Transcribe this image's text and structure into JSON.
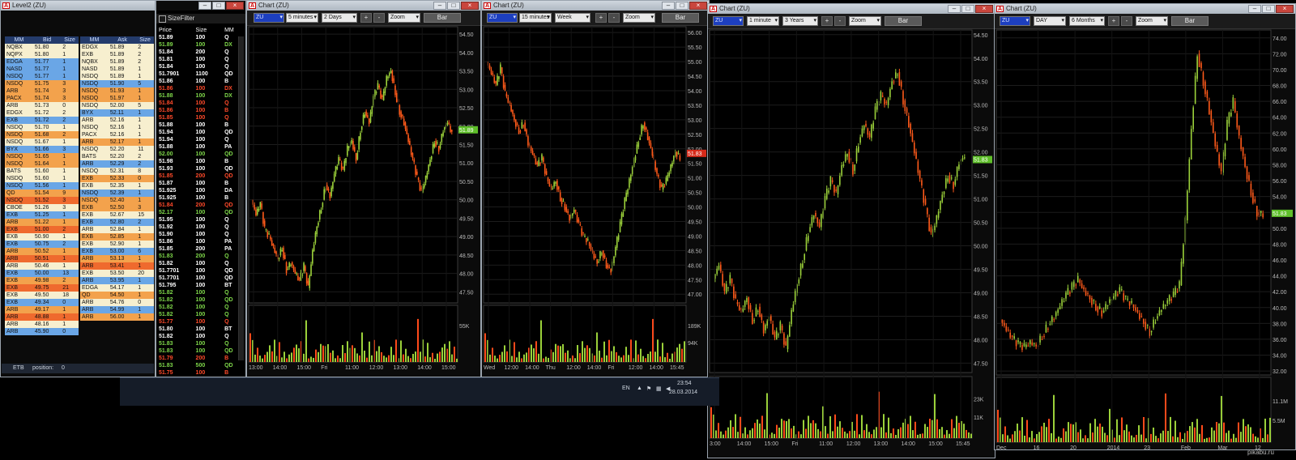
{
  "level2": {
    "title": "Level2 (ZU)",
    "bid_headers": [
      "MM",
      "Bid",
      "Size"
    ],
    "ask_headers": [
      "MM",
      "Ask",
      "Size"
    ],
    "bids": [
      [
        "NQBX",
        "51.80",
        "2",
        "cream"
      ],
      [
        "NQPX",
        "51.80",
        "1",
        "cream"
      ],
      [
        "EDGA",
        "51.77",
        "1",
        "blue"
      ],
      [
        "NASD",
        "51.77",
        "1",
        "blue"
      ],
      [
        "NSDQ",
        "51.77",
        "1",
        "blue"
      ],
      [
        "NSDQ",
        "51.75",
        "3",
        "orange"
      ],
      [
        "ARB",
        "51.74",
        "3",
        "orange"
      ],
      [
        "PACX",
        "51.74",
        "3",
        "orange"
      ],
      [
        "ARB",
        "51.73",
        "0",
        "cream"
      ],
      [
        "EDGX",
        "51.72",
        "2",
        "cream"
      ],
      [
        "EXB",
        "51.72",
        "2",
        "blue"
      ],
      [
        "NSDQ",
        "51.70",
        "1",
        "cream"
      ],
      [
        "NSDQ",
        "51.68",
        "2",
        "orange"
      ],
      [
        "NSDQ",
        "51.67",
        "1",
        "cream"
      ],
      [
        "BYX",
        "51.66",
        "3",
        "blue"
      ],
      [
        "NSDQ",
        "51.65",
        "1",
        "orange"
      ],
      [
        "NSDQ",
        "51.64",
        "1",
        "orange"
      ],
      [
        "BATS",
        "51.60",
        "1",
        "cream"
      ],
      [
        "NSDQ",
        "51.60",
        "1",
        "cream"
      ],
      [
        "NSDQ",
        "51.56",
        "1",
        "blue"
      ],
      [
        "QD",
        "51.54",
        "9",
        "orange"
      ],
      [
        "NSDQ",
        "51.52",
        "3",
        "red"
      ],
      [
        "CBOE",
        "51.26",
        "3",
        "cream"
      ],
      [
        "EXB",
        "51.25",
        "1",
        "blue"
      ],
      [
        "ARB",
        "51.22",
        "1",
        "orange"
      ],
      [
        "EXB",
        "51.00",
        "2",
        "red"
      ],
      [
        "EXB",
        "50.90",
        "1",
        "cream"
      ],
      [
        "EXB",
        "50.75",
        "2",
        "blue"
      ],
      [
        "ARB",
        "50.52",
        "1",
        "orange"
      ],
      [
        "ARB",
        "50.51",
        "1",
        "red"
      ],
      [
        "ARB",
        "50.46",
        "1",
        "cream"
      ],
      [
        "EXB",
        "50.00",
        "13",
        "blue"
      ],
      [
        "EXB",
        "49.98",
        "2",
        "orange"
      ],
      [
        "EXB",
        "49.75",
        "21",
        "red"
      ],
      [
        "EXB",
        "49.50",
        "18",
        "cream"
      ],
      [
        "EXB",
        "49.34",
        "0",
        "blue"
      ],
      [
        "ARB",
        "49.17",
        "1",
        "orange"
      ],
      [
        "ARB",
        "48.88",
        "1",
        "red"
      ],
      [
        "ARB",
        "48.16",
        "1",
        "cream"
      ],
      [
        "ARB",
        "45.90",
        "0",
        "blue"
      ]
    ],
    "asks": [
      [
        "EDGX",
        "51.89",
        "2",
        "cream"
      ],
      [
        "EXB",
        "51.89",
        "2",
        "cream"
      ],
      [
        "NQBX",
        "51.89",
        "2",
        "cream"
      ],
      [
        "NASD",
        "51.89",
        "1",
        "cream"
      ],
      [
        "NSDQ",
        "51.89",
        "1",
        "cream"
      ],
      [
        "NSDQ",
        "51.90",
        "5",
        "blue"
      ],
      [
        "NSDQ",
        "51.93",
        "1",
        "orange"
      ],
      [
        "NSDQ",
        "51.97",
        "1",
        "orange"
      ],
      [
        "NSDQ",
        "52.00",
        "5",
        "cream"
      ],
      [
        "BYX",
        "52.11",
        "1",
        "blue"
      ],
      [
        "ARB",
        "52.16",
        "1",
        "cream"
      ],
      [
        "NSDQ",
        "52.16",
        "1",
        "cream"
      ],
      [
        "PACX",
        "52.16",
        "1",
        "cream"
      ],
      [
        "ARB",
        "52.17",
        "1",
        "orange"
      ],
      [
        "NSDQ",
        "52.20",
        "11",
        "cream"
      ],
      [
        "BATS",
        "52.20",
        "2",
        "cream"
      ],
      [
        "ARB",
        "52.29",
        "2",
        "blue"
      ],
      [
        "NSDQ",
        "52.31",
        "8",
        "cream"
      ],
      [
        "EXB",
        "52.33",
        "0",
        "orange"
      ],
      [
        "EXB",
        "52.35",
        "1",
        "cream"
      ],
      [
        "NSDQ",
        "52.39",
        "1",
        "blue"
      ],
      [
        "NSDQ",
        "52.40",
        "1",
        "orange"
      ],
      [
        "EXB",
        "52.50",
        "3",
        "orange"
      ],
      [
        "EXB",
        "52.67",
        "15",
        "cream"
      ],
      [
        "EXB",
        "52.80",
        "2",
        "blue"
      ],
      [
        "ARB",
        "52.84",
        "1",
        "cream"
      ],
      [
        "EXB",
        "52.85",
        "1",
        "orange"
      ],
      [
        "EXB",
        "52.90",
        "1",
        "cream"
      ],
      [
        "EXB",
        "53.00",
        "6",
        "blue"
      ],
      [
        "ARB",
        "53.13",
        "1",
        "orange"
      ],
      [
        "ARB",
        "53.41",
        "1",
        "red"
      ],
      [
        "EXB",
        "53.50",
        "20",
        "cream"
      ],
      [
        "ARB",
        "53.95",
        "1",
        "blue"
      ],
      [
        "EDGA",
        "54.17",
        "1",
        "cream"
      ],
      [
        "QD",
        "54.50",
        "1",
        "orange"
      ],
      [
        "ARB",
        "54.76",
        "0",
        "cream"
      ],
      [
        "ARB",
        "54.99",
        "1",
        "blue"
      ],
      [
        "ARB",
        "56.00",
        "1",
        "orange"
      ]
    ],
    "status_symbol": "ETB",
    "status_position_label": "position:",
    "status_position_value": "0"
  },
  "sizefilter": {
    "title": "SizeFilter",
    "headers": [
      "Price",
      "Size",
      "MM"
    ],
    "rows": [
      [
        "51.89",
        "100",
        "Q",
        "w"
      ],
      [
        "51.89",
        "100",
        "DX",
        "g"
      ],
      [
        "51.84",
        "200",
        "Q",
        "w"
      ],
      [
        "51.81",
        "100",
        "Q",
        "w"
      ],
      [
        "51.84",
        "100",
        "Q",
        "w"
      ],
      [
        "51.7901",
        "1100",
        "QD",
        "w"
      ],
      [
        "51.86",
        "100",
        "B",
        "w"
      ],
      [
        "51.86",
        "100",
        "DX",
        "r"
      ],
      [
        "51.88",
        "100",
        "DX",
        "g"
      ],
      [
        "51.84",
        "100",
        "Q",
        "r"
      ],
      [
        "51.86",
        "100",
        "B",
        "r"
      ],
      [
        "51.85",
        "100",
        "Q",
        "r"
      ],
      [
        "51.88",
        "100",
        "B",
        "w"
      ],
      [
        "51.94",
        "100",
        "QD",
        "w"
      ],
      [
        "51.94",
        "100",
        "Q",
        "w"
      ],
      [
        "51.88",
        "100",
        "PA",
        "w"
      ],
      [
        "52.00",
        "100",
        "QD",
        "g"
      ],
      [
        "51.98",
        "100",
        "B",
        "w"
      ],
      [
        "51.93",
        "100",
        "QD",
        "w"
      ],
      [
        "51.85",
        "200",
        "QD",
        "r"
      ],
      [
        "51.87",
        "100",
        "B",
        "w"
      ],
      [
        "51.925",
        "100",
        "DA",
        "w"
      ],
      [
        "51.925",
        "100",
        "B",
        "w"
      ],
      [
        "51.84",
        "200",
        "QD",
        "r"
      ],
      [
        "52.17",
        "100",
        "QD",
        "g"
      ],
      [
        "51.95",
        "100",
        "Q",
        "w"
      ],
      [
        "51.92",
        "100",
        "Q",
        "w"
      ],
      [
        "51.90",
        "100",
        "Q",
        "w"
      ],
      [
        "51.86",
        "100",
        "PA",
        "w"
      ],
      [
        "51.85",
        "200",
        "PA",
        "w"
      ],
      [
        "51.83",
        "200",
        "Q",
        "g"
      ],
      [
        "51.82",
        "100",
        "Q",
        "w"
      ],
      [
        "51.7701",
        "100",
        "QD",
        "w"
      ],
      [
        "51.7701",
        "100",
        "QD",
        "w"
      ],
      [
        "51.795",
        "100",
        "BT",
        "w"
      ],
      [
        "51.82",
        "100",
        "Q",
        "g"
      ],
      [
        "51.82",
        "100",
        "QD",
        "g"
      ],
      [
        "51.82",
        "100",
        "Q",
        "g"
      ],
      [
        "51.82",
        "100",
        "Q",
        "g"
      ],
      [
        "51.77",
        "100",
        "Q",
        "r"
      ],
      [
        "51.80",
        "100",
        "BT",
        "w"
      ],
      [
        "51.82",
        "100",
        "Q",
        "w"
      ],
      [
        "51.83",
        "100",
        "Q",
        "g"
      ],
      [
        "51.83",
        "100",
        "QD",
        "g"
      ],
      [
        "51.79",
        "200",
        "B",
        "r"
      ],
      [
        "51.83",
        "500",
        "QD",
        "g"
      ],
      [
        "51.75",
        "100",
        "B",
        "r"
      ],
      [
        "51.83",
        "100",
        "PA",
        "w"
      ],
      [
        "51.75",
        "100",
        "B",
        "r"
      ]
    ]
  },
  "charts": [
    {
      "title": "Chart (ZU)",
      "symbol": "ZU",
      "interval": "5 minutes",
      "range": "2 Days",
      "zoom": "Zoom",
      "bar_label": "Bar",
      "plus": "+",
      "minus": "-",
      "price_ticks": [
        "54.50",
        "54.00",
        "53.50",
        "53.00",
        "52.50",
        "52.00",
        "51.50",
        "51.00",
        "50.50",
        "50.00",
        "49.50",
        "49.00",
        "48.50",
        "48.00",
        "47.50"
      ],
      "price_range": [
        47.2,
        54.7
      ],
      "last_price": "51.89",
      "volume_ticks": [
        "55K"
      ],
      "time_ticks": [
        "13:00",
        "14:00",
        "15:00",
        "Fri",
        "11:00",
        "12:00",
        "13:00",
        "14:00",
        "15:00"
      ],
      "series": [
        50.0,
        49.6,
        49.9,
        49.2,
        49.0,
        48.7,
        48.4,
        48.7,
        48.1,
        48.3,
        48.0,
        47.8,
        48.2,
        47.6,
        48.6,
        49.3,
        49.8,
        50.4,
        50.1,
        50.7,
        51.1,
        50.8,
        51.4,
        51.6,
        51.1,
        51.9,
        52.4,
        52.1,
        52.8,
        53.1,
        52.7,
        53.3,
        53.5,
        52.9,
        52.4,
        52.1,
        51.6,
        51.1,
        50.6,
        50.2,
        50.6,
        51.1,
        51.6,
        51.4,
        51.9,
        52.1,
        51.8
      ]
    },
    {
      "title": "Chart (ZU)",
      "symbol": "ZU",
      "interval": "15 minutes",
      "range": "Week",
      "zoom": "Zoom",
      "bar_label": "Bar",
      "plus": "+",
      "minus": "-",
      "price_ticks": [
        "56.00",
        "55.50",
        "55.00",
        "54.50",
        "54.00",
        "53.50",
        "53.00",
        "52.50",
        "52.00",
        "51.50",
        "51.00",
        "50.50",
        "50.00",
        "49.50",
        "49.00",
        "48.50",
        "48.00",
        "47.50",
        "47.00"
      ],
      "price_range": [
        46.7,
        56.2
      ],
      "last_price": "51.83",
      "volume_ticks": [
        "189K",
        "94K"
      ],
      "time_ticks": [
        "Wed",
        "12:00",
        "14:00",
        "Thu",
        "12:00",
        "14:00",
        "Fri",
        "12:00",
        "14:00",
        "15:45"
      ],
      "series": [
        55.0,
        54.6,
        54.2,
        54.8,
        53.9,
        53.5,
        53.0,
        52.6,
        52.9,
        52.2,
        51.8,
        51.4,
        51.7,
        51.0,
        50.6,
        50.9,
        50.3,
        50.0,
        49.6,
        49.9,
        49.4,
        49.0,
        48.8,
        48.4,
        48.1,
        48.5,
        48.0,
        47.8,
        48.6,
        49.4,
        50.2,
        50.9,
        51.6,
        52.3,
        52.9,
        52.4,
        51.8,
        51.1,
        50.6,
        50.9,
        51.4,
        51.9,
        51.7
      ]
    },
    {
      "title": "Chart (ZU)",
      "symbol": "ZU",
      "interval": "1 minute",
      "range": "3 Years",
      "zoom": "Zoom",
      "bar_label": "Bar",
      "plus": "+",
      "minus": "-",
      "price_ticks": [
        "54.50",
        "54.00",
        "53.50",
        "53.00",
        "52.50",
        "52.00",
        "51.50",
        "51.00",
        "50.50",
        "50.00",
        "49.50",
        "49.00",
        "48.50",
        "48.00",
        "47.50"
      ],
      "price_range": [
        47.3,
        54.6
      ],
      "last_price": "51.83",
      "volume_ticks": [
        "23K",
        "11K"
      ],
      "time_ticks": [
        "3:00",
        "14:00",
        "15:00",
        "Fri",
        "11:00",
        "12:00",
        "13:00",
        "14:00",
        "15:00",
        "15:45"
      ],
      "series": [
        49.3,
        49.6,
        49.0,
        49.3,
        48.8,
        48.6,
        48.9,
        48.4,
        48.7,
        48.2,
        48.5,
        48.0,
        48.3,
        47.8,
        48.6,
        49.2,
        49.7,
        50.3,
        50.7,
        50.4,
        51.0,
        51.4,
        51.1,
        51.7,
        52.0,
        51.6,
        52.2,
        52.6,
        52.3,
        52.9,
        53.2,
        53.0,
        53.5,
        53.7,
        53.1,
        52.6,
        52.0,
        51.4,
        50.8,
        50.2,
        50.6,
        51.1,
        51.5,
        51.3,
        51.8,
        51.9
      ]
    },
    {
      "title": "Chart (ZU)",
      "symbol": "ZU",
      "interval": "DAY",
      "range": "6 Months",
      "zoom": "Zoom",
      "bar_label": "Bar",
      "plus": "+",
      "minus": "-",
      "price_ticks": [
        "74.00",
        "72.00",
        "70.00",
        "68.00",
        "66.00",
        "64.00",
        "62.00",
        "60.00",
        "58.00",
        "56.00",
        "54.00",
        "52.00",
        "50.00",
        "48.00",
        "46.00",
        "44.00",
        "42.00",
        "40.00",
        "38.00",
        "36.00",
        "34.00",
        "32.00"
      ],
      "price_range": [
        31.5,
        75.0
      ],
      "last_price": "51.83",
      "volume_ticks": [
        "11.1M",
        "5.5M"
      ],
      "time_ticks": [
        "Dec",
        "16",
        "20",
        "2014",
        "23",
        "Feb",
        "Mar",
        "12"
      ],
      "series": [
        38.5,
        37.2,
        36.1,
        35.4,
        35.0,
        35.6,
        35.2,
        36.4,
        37.8,
        38.9,
        40.2,
        41.6,
        42.6,
        43.5,
        42.1,
        41.2,
        40.1,
        39.4,
        40.6,
        41.4,
        42.2,
        41.0,
        40.4,
        39.3,
        38.2,
        36.9,
        38.6,
        39.9,
        40.8,
        41.6,
        42.8,
        51.0,
        62.5,
        72.0,
        68.5,
        64.8,
        60.5,
        57.0,
        63.2,
        66.0,
        61.4,
        57.8,
        54.5,
        52.0,
        51.8
      ]
    }
  ],
  "taskbar": {
    "lang": "EN",
    "time": "23:54",
    "date": "28.03.2014"
  },
  "watermark": "pikabu.ru"
}
